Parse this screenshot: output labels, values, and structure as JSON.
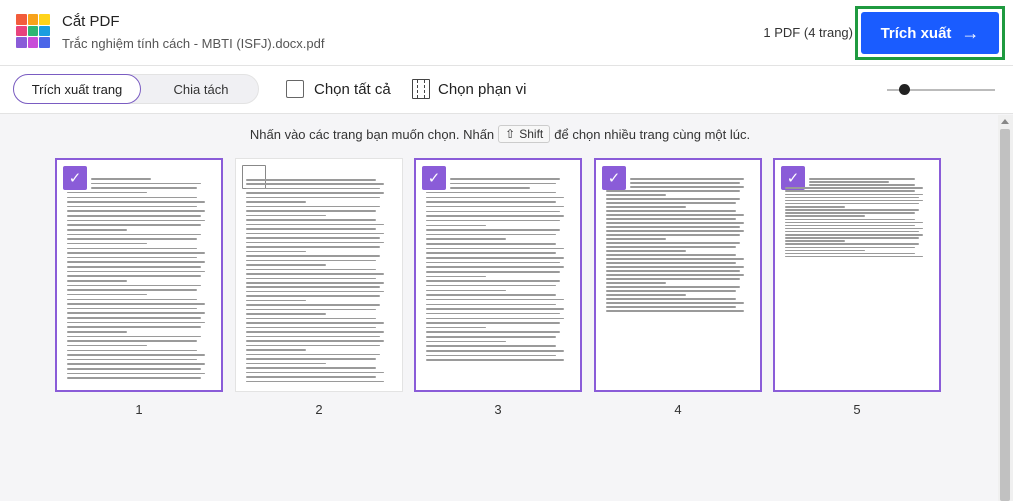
{
  "header": {
    "app_title": "Cắt PDF",
    "file_name": "Trắc nghiệm tính cách - MBTI (ISFJ).docx.pdf",
    "pdf_count": "1 PDF (4 trang)",
    "extract_label": "Trích xuất",
    "logo_colors": [
      "#f25c3b",
      "#f7a21b",
      "#ffd31a",
      "#e8437d",
      "#2bb673",
      "#1a9ee0",
      "#8a5cd8",
      "#c84cd8",
      "#4b66e8"
    ]
  },
  "toolbar": {
    "tab_extract": "Trích xuất trang",
    "tab_split": "Chia tách",
    "select_all": "Chọn tất cả",
    "select_range": "Chọn phạn vi"
  },
  "instruction": {
    "before": "Nhấn vào các trang bạn muốn chọn. Nhấn",
    "shift": "Shift",
    "after": "để chọn nhiều trang cùng một lúc."
  },
  "pages": [
    {
      "number": "1",
      "selected": true
    },
    {
      "number": "2",
      "selected": false
    },
    {
      "number": "3",
      "selected": true
    },
    {
      "number": "4",
      "selected": true
    },
    {
      "number": "5",
      "selected": true
    }
  ],
  "colors": {
    "accent": "#1a5cff",
    "selection": "#8a5cd8",
    "highlight_frame": "#1f9a3f"
  }
}
